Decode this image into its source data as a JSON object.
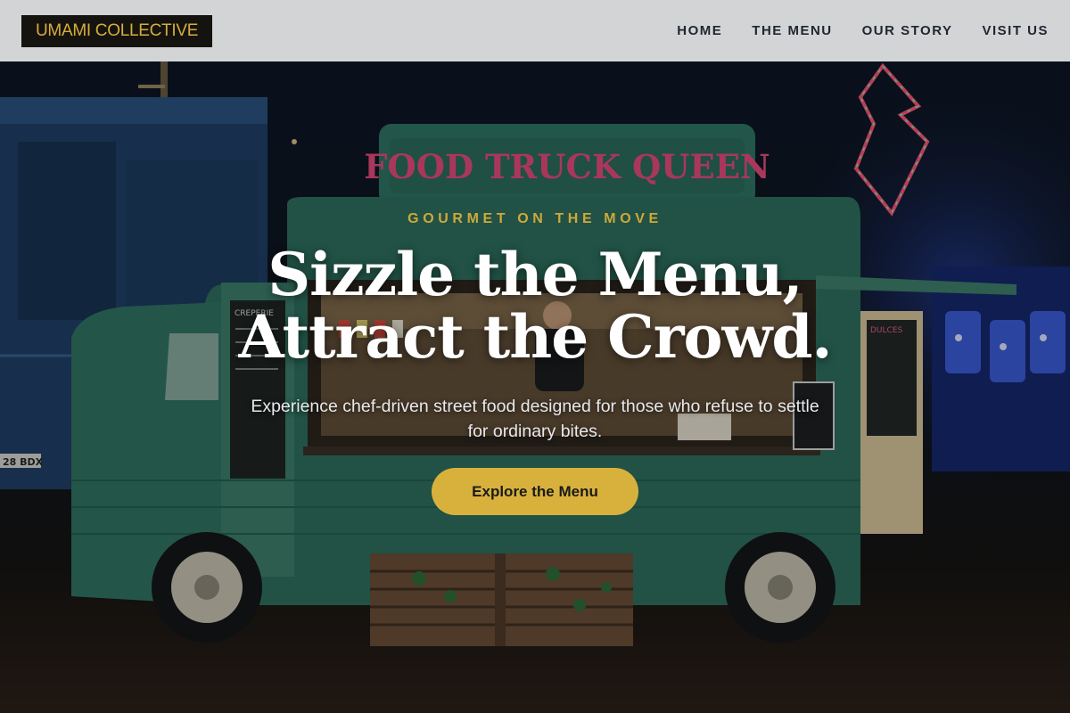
{
  "brand": {
    "logo_text": "UMAMI COLLECTIVE"
  },
  "nav": {
    "items": [
      {
        "label": "HOME"
      },
      {
        "label": "THE MENU"
      },
      {
        "label": "OUR STORY"
      },
      {
        "label": "VISIT US"
      }
    ]
  },
  "hero": {
    "eyebrow": "GOURMET ON THE MOVE",
    "headline_line1": "Sizzle the Menu,",
    "headline_line2": "Attract the Crowd.",
    "subtext": "Experience chef-driven street food designed for those who refuse to settle for ordinary bites.",
    "cta_label": "Explore the Menu"
  },
  "photo": {
    "truck_sign": "FOOD TRUCK QUEEN",
    "menu_board_left": "CREPERIE",
    "menu_board_right": "DULCES",
    "plate_text": "28 BDX"
  },
  "colors": {
    "accent_gold": "#d8b13d",
    "nav_background": "#d3d4d6",
    "logo_background": "#141310",
    "truck_green": "#2b6e5a"
  }
}
